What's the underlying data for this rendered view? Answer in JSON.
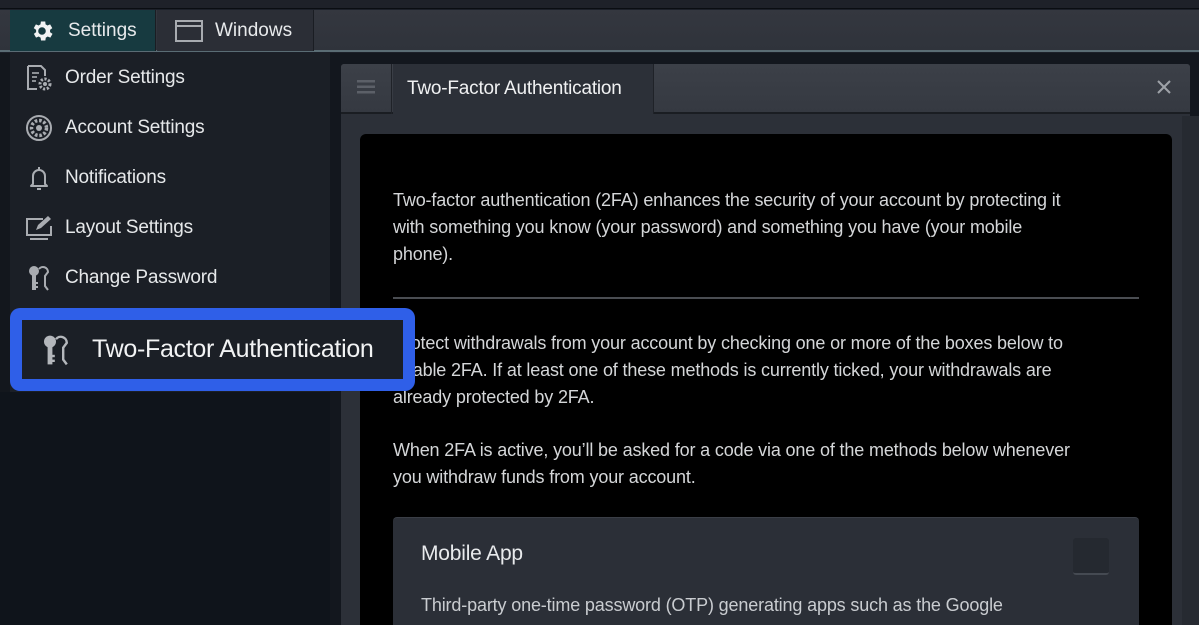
{
  "menubar": {
    "tabs": [
      {
        "label": "Settings",
        "icon": "gear-icon",
        "active": true
      },
      {
        "label": "Windows",
        "icon": "window-icon",
        "active": false
      }
    ]
  },
  "sidebar": {
    "items": [
      {
        "label": "Order Settings",
        "icon": "document-gear-icon"
      },
      {
        "label": "Account Settings",
        "icon": "cog-circle-icon"
      },
      {
        "label": "Notifications",
        "icon": "bell-icon"
      },
      {
        "label": "Layout Settings",
        "icon": "monitor-edit-icon"
      },
      {
        "label": "Change Password",
        "icon": "keys-icon"
      }
    ],
    "selected": {
      "label": "Two-Factor Authentication",
      "icon": "keys-icon"
    }
  },
  "panel": {
    "tab_label": "Two-Factor Authentication",
    "close_icon": "close-icon",
    "handle_icon": "drag-handle-icon"
  },
  "content": {
    "intro_lines": [
      "Two-factor authentication (2FA) enhances the security of your account by protecting it",
      "with something you know (your password) and something you have (your mobile",
      "phone)."
    ],
    "protect_lines": [
      "Protect withdrawals from your account by checking one or more of the boxes below to",
      "enable 2FA. If at least one of these methods is currently ticked, your withdrawals are",
      "already protected by 2FA."
    ],
    "active_lines": [
      "When 2FA is active, you’ll be asked for a code via one of the methods below whenever",
      "you withdraw funds from your account."
    ],
    "methods": [
      {
        "title": "Mobile App",
        "checked": false,
        "description": "Third-party one-time password (OTP) generating apps such as the Google"
      }
    ]
  },
  "colors": {
    "highlight": "#2f5fe8",
    "settings_tab": "#173a40",
    "card_background": "#000000"
  }
}
